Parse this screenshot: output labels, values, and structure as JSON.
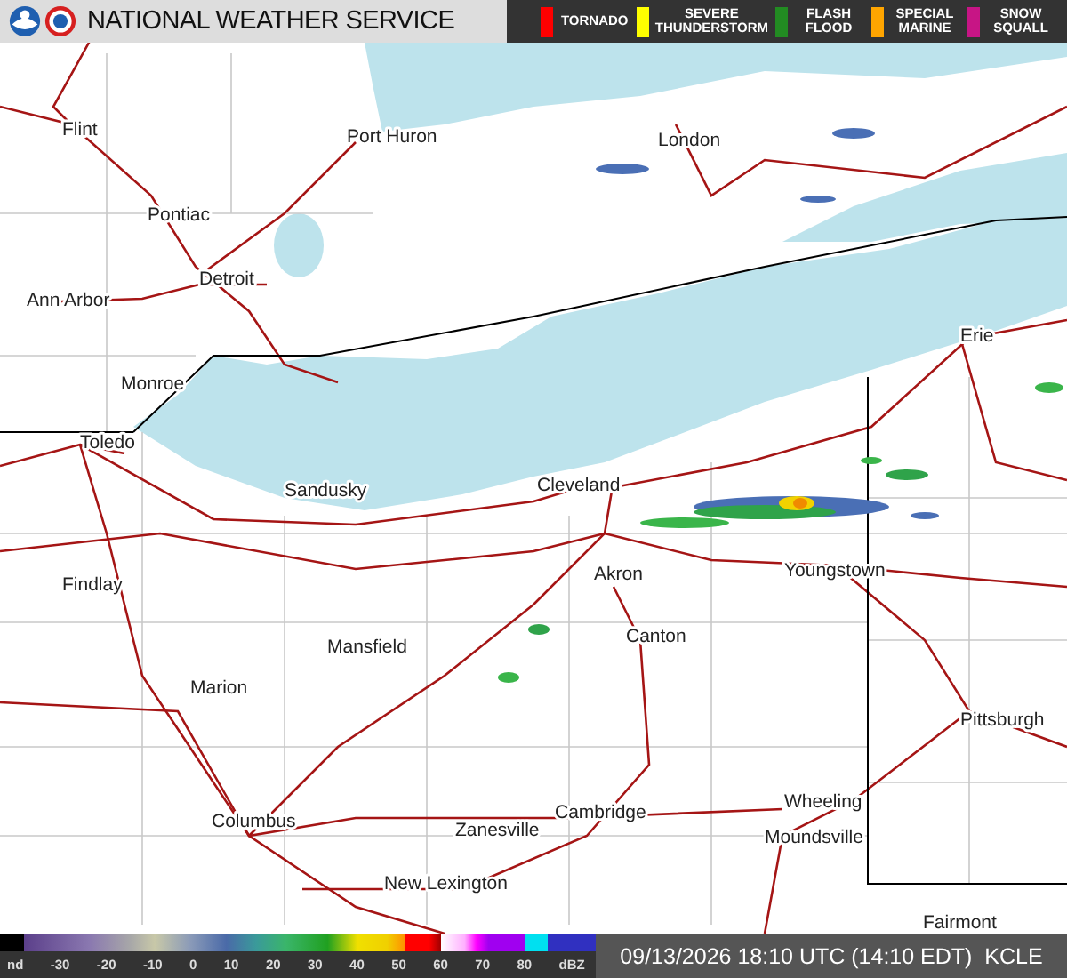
{
  "header": {
    "title": "NATIONAL WEATHER SERVICE"
  },
  "warnings_legend": [
    {
      "label": "TORNADO",
      "color": "#ff0000"
    },
    {
      "label": "SEVERE\nTHUNDERSTORM",
      "color": "#ffff00"
    },
    {
      "label": "FLASH\nFLOOD",
      "color": "#228b22"
    },
    {
      "label": "SPECIAL\nMARINE",
      "color": "#ffa500"
    },
    {
      "label": "SNOW\nSQUALL",
      "color": "#c71585"
    }
  ],
  "map": {
    "cities": [
      "Flint",
      "Port Huron",
      "London",
      "Pontiac",
      "Detroit",
      "Ann Arbor",
      "Monroe",
      "Toledo",
      "Sandusky",
      "Cleveland",
      "Erie",
      "Findlay",
      "Akron",
      "Youngstown",
      "Mansfield",
      "Canton",
      "Marion",
      "Pittsburgh",
      "Columbus",
      "Wheeling",
      "Cambridge",
      "Moundsville",
      "Zanesville",
      "New Lexington",
      "Fairmont"
    ]
  },
  "color_scale": {
    "labels": [
      "nd",
      "-30",
      "-20",
      "-10",
      "0",
      "10",
      "20",
      "30",
      "40",
      "50",
      "60",
      "70",
      "80",
      "dBZ"
    ]
  },
  "timestamp": "09/13/2026 18:10 UTC (14:10 EDT)  KCLE"
}
